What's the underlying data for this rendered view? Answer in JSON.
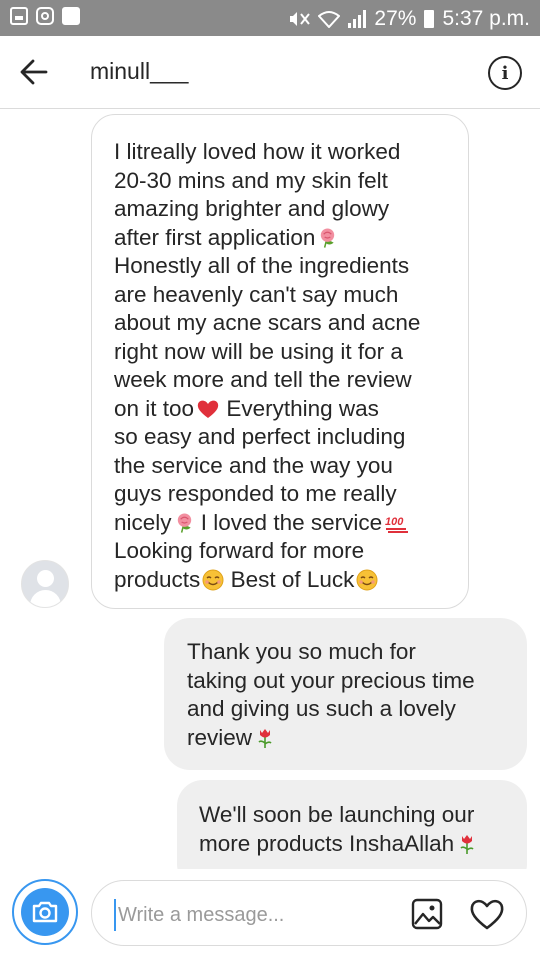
{
  "status_bar": {
    "battery": "27%",
    "time": "5:37 p.m."
  },
  "header": {
    "username": "minull___"
  },
  "messages": {
    "received": {
      "lines": [
        "I litreally loved how it worked",
        "20-30 mins and my skin felt",
        "amazing brighter and glowy",
        "after first application",
        "Honestly all of the ingredients",
        "are heavenly can't say much",
        "about my acne scars and acne",
        "right now will be using it for a",
        "week more and tell the review",
        "on it too",
        " Everything was",
        "so easy and perfect including",
        "the service and the way you",
        "guys responded to me really",
        "nicely",
        " I loved the service",
        "Looking forward for more",
        "products",
        " Best of Luck"
      ]
    },
    "sent_1": {
      "lines": [
        "Thank you so much for",
        "taking out your precious time",
        "and giving us such a lovely",
        "review"
      ]
    },
    "sent_2": {
      "lines": [
        "We'll soon be launching our",
        "more products InshaAllah"
      ]
    }
  },
  "composer": {
    "placeholder": "Write a message..."
  },
  "colors": {
    "accent": "#3897f0",
    "status_bar": "#8a8a8a",
    "sent_bubble": "#efefef"
  },
  "icons": [
    "back-arrow-icon",
    "info-icon",
    "camera-icon",
    "gallery-icon",
    "heart-icon",
    "rose-emoji",
    "red-heart-emoji",
    "hundred-emoji",
    "smiling-face-emoji",
    "tulip-emoji"
  ]
}
